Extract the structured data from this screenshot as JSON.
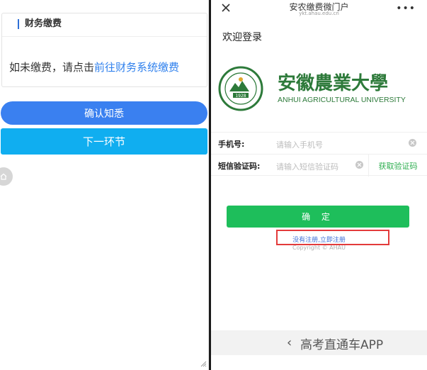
{
  "left": {
    "section_title": "财务缴费",
    "notice_prefix": "如未缴费，请点击",
    "notice_link": "前往财务系统缴费",
    "confirm_button": "确认知悉",
    "next_button": "下一环节"
  },
  "right": {
    "title": "安农缴费微门户",
    "url": "ykt.ahau.edu.cn",
    "more_label": "•••",
    "welcome": "欢迎登录",
    "logo": {
      "name_cn": "安徽農業大學",
      "name_en": "ANHUI AGRICULTURAL UNIVERSITY",
      "seal_year": "1928"
    },
    "form": {
      "phone_label": "手机号:",
      "phone_placeholder": "请输入手机号",
      "code_label": "短信验证码:",
      "code_placeholder": "请输入短信验证码",
      "sms_button": "获取验证码"
    },
    "submit": "确 定",
    "register_link": "没有注册,立即注册",
    "copyright": "Copyright © AHAU"
  },
  "bottom_bar": {
    "back_glyph": "‹",
    "label": "高考直通车APP"
  },
  "colors": {
    "primary_blue": "#3a80f0",
    "cyan_button": "#10aef0",
    "green": "#1ebe5b",
    "logo_green": "#2d7a3a",
    "highlight_red": "#e33b3b"
  }
}
